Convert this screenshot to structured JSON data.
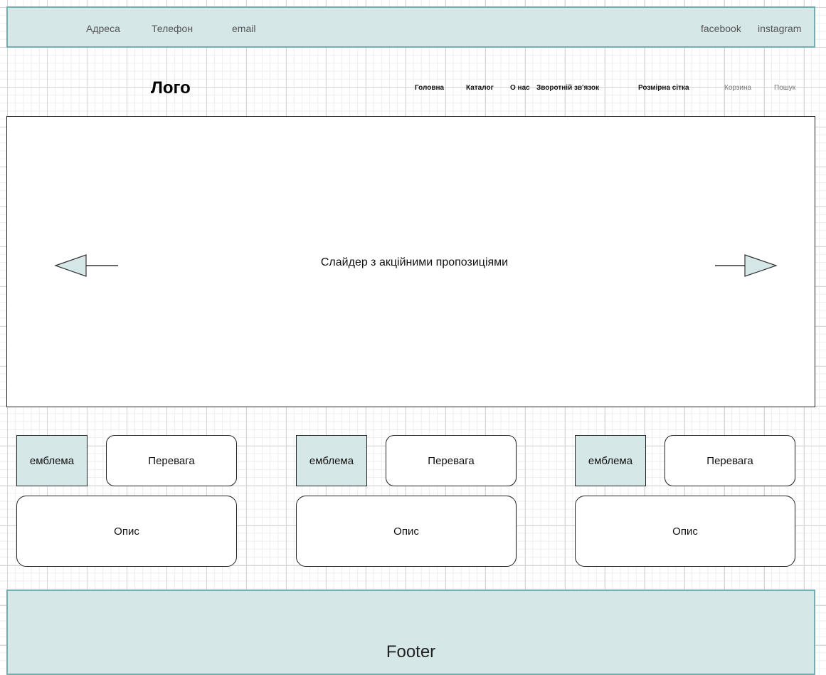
{
  "top_bar": {
    "address": "Адреса",
    "phone": "Телефон",
    "email": "email",
    "facebook": "facebook",
    "instagram": "instagram"
  },
  "header": {
    "logo": "Лого",
    "nav": [
      "Головна",
      "Каталог",
      "О нас",
      "Зворотній зв'язок",
      "Розмірна сітка"
    ],
    "cart": "Корзина",
    "search": "Пошук"
  },
  "slider": {
    "text": "Слайдер з акційними пропозиціями",
    "prev_icon": "arrow-left-icon",
    "next_icon": "arrow-right-icon"
  },
  "features": [
    {
      "emblem": "емблема",
      "advantage": "Перевага",
      "description": "Опис"
    },
    {
      "emblem": "емблема",
      "advantage": "Перевага",
      "description": "Опис"
    },
    {
      "emblem": "емблема",
      "advantage": "Перевага",
      "description": "Опис"
    }
  ],
  "footer": {
    "text": "Footer"
  },
  "colors": {
    "accent_fill": "#d6e7e7",
    "accent_border": "#6fb0b0",
    "outline": "#222222"
  }
}
